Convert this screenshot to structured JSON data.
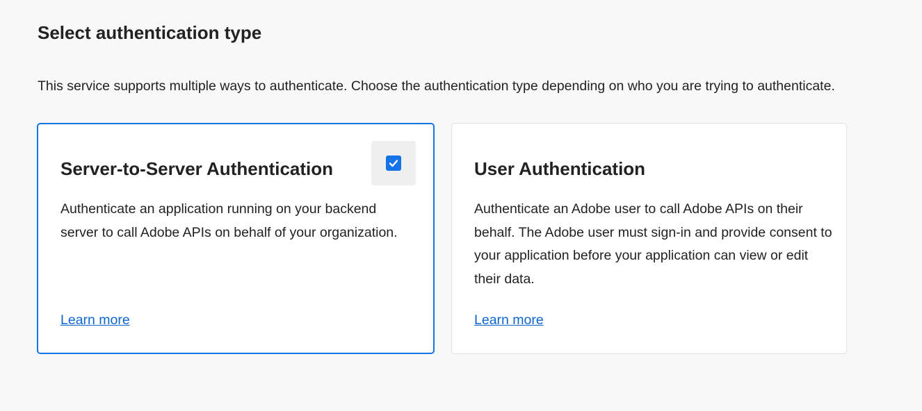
{
  "page": {
    "title": "Select authentication type",
    "description": "This service supports multiple ways to authenticate. Choose the authentication type depending on who you are trying to authenticate."
  },
  "cards": [
    {
      "title": "Server-to-Server Authentication",
      "description": "Authenticate an application running on your backend server to call Adobe APIs on behalf of your organization.",
      "link": "Learn more",
      "selected": true
    },
    {
      "title": "User Authentication",
      "description": "Authenticate an Adobe user to call Adobe APIs on their behalf. The Adobe user must sign-in and provide consent to your application before your application can view or edit their data.",
      "link": "Learn more",
      "selected": false
    }
  ],
  "icons": {
    "checkbox": "checkmark-icon"
  },
  "colors": {
    "accent": "#1473e6",
    "link": "#0d66d0",
    "background": "#f8f8f8",
    "card_background": "#ffffff"
  }
}
